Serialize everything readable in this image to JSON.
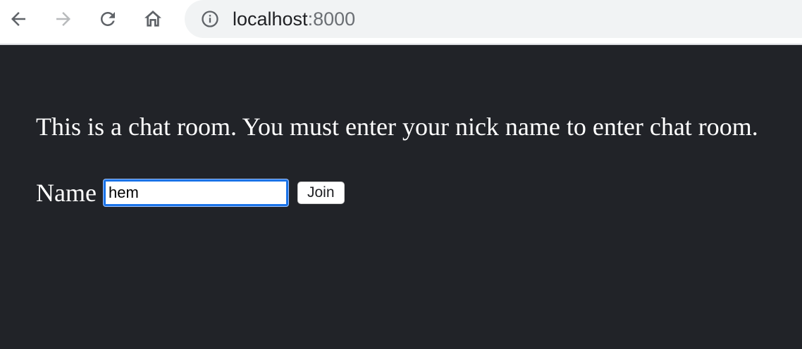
{
  "browser": {
    "address_bar": {
      "host": "localhost",
      "port": ":8000"
    },
    "icons": {
      "back": "back-arrow-icon",
      "forward": "forward-arrow-icon",
      "reload": "reload-icon",
      "home": "home-icon",
      "site_info": "info-icon"
    },
    "colors": {
      "icon_active": "#5f6368",
      "icon_disabled": "#b8babc",
      "omnibox_bg": "#f1f3f4"
    }
  },
  "page": {
    "intro_text": "This is a chat room. You must enter your nick name to enter chat room.",
    "form": {
      "name_label": "Name",
      "name_value": "hem",
      "join_label": "Join"
    },
    "colors": {
      "background": "#212328",
      "text": "#ffffff",
      "focus_ring": "#1a73e8"
    }
  }
}
